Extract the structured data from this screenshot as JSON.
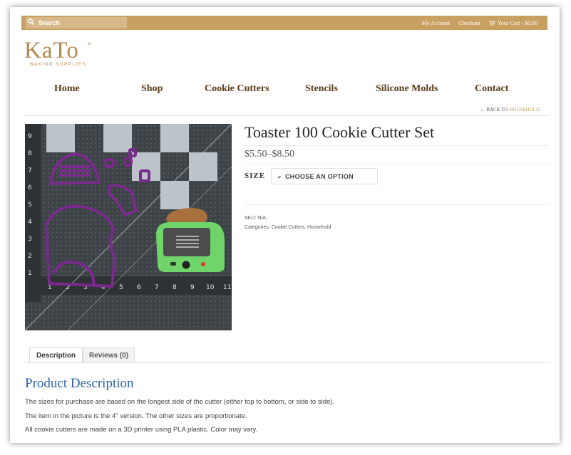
{
  "header": {
    "search_placeholder": "Search",
    "search_icon": "search-icon",
    "links": [
      "My Account",
      "Checkout"
    ],
    "cart_label": "Your Cart - $0.00",
    "cart_icon": "cart-icon",
    "bar_color": "#c8a062"
  },
  "logo": {
    "name": "KaTo",
    "tagline": "BAKING SUPPLIES",
    "reg": "®"
  },
  "nav": [
    "Home",
    "Shop",
    "Cookie Cutters",
    "Stencils",
    "Silicone Molds",
    "Contact"
  ],
  "breadcrumb": {
    "back_label": "BACK TO",
    "category": "HOUSEHOLD"
  },
  "product": {
    "title": "Toaster 100 Cookie Cutter Set",
    "price": "$5.50–$8.50",
    "size_label": "SIZE",
    "size_select": "CHOOSE AN OPTION",
    "sku_label": "SKU:",
    "sku": "N/A",
    "categories_label": "Categories:",
    "categories": [
      "Cookie Cutters",
      "Household"
    ]
  },
  "tabs": [
    "Description",
    "Reviews (0)"
  ],
  "description": {
    "heading": "Product Description",
    "paragraphs": [
      "The sizes for purchase are based on the longest side of the cutter (either top to bottom, or side to side).",
      "The item in the picture is the 4\" version. The other sizes are proportionate.",
      "All cookie cutters are made on a 3D printer using PLA plastic. Color may vary."
    ]
  },
  "colors": {
    "accent": "#c8a062",
    "nav_text": "#5a3c18",
    "heading_blue": "#2d63a8",
    "cutter_purple": "#7a2a8c"
  }
}
